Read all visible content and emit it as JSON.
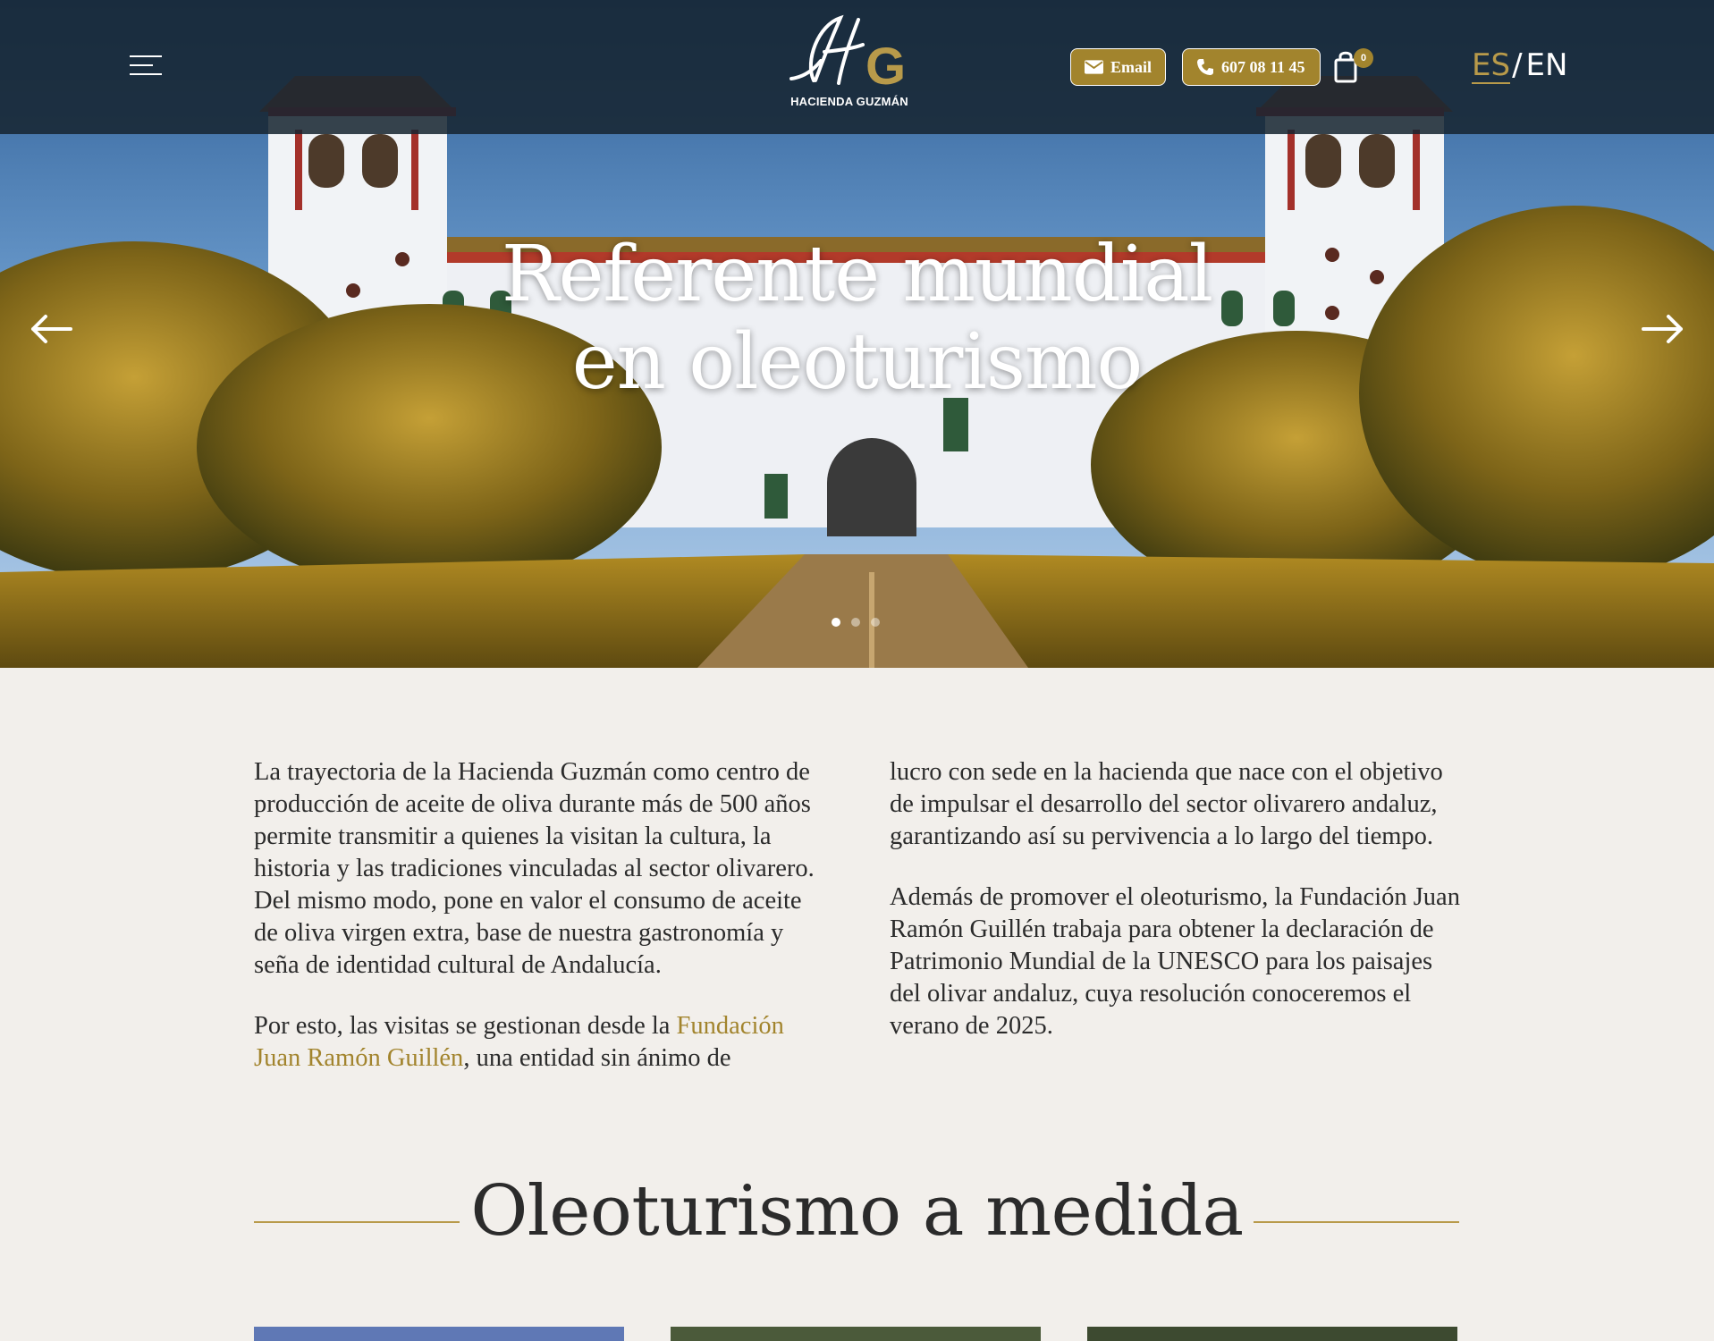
{
  "header": {
    "logo_text": "HACIENDA GUZMÁN",
    "logo_letters": "HG",
    "email_label": "Email",
    "phone_label": "607 08 11 45",
    "cart_count": "0",
    "lang_es": "ES",
    "lang_separator": "/",
    "lang_en": "EN",
    "icons": [
      "menu-icon",
      "email-icon",
      "phone-icon",
      "shopping-bag-icon",
      "arrow-left-icon",
      "arrow-right-icon"
    ]
  },
  "hero": {
    "title_line1": "Referente mundial",
    "title_line2": "en oleoturismo",
    "slides_total": 3,
    "active_slide": 1
  },
  "intro": {
    "para1": "La trayectoria de la Hacienda Guzmán como centro de producción de aceite de oliva durante más de 500 años permite transmitir a quienes la visitan la cultura, la historia y las tradiciones vinculadas al sector olivarero. Del mismo modo, pone en valor el consumo de aceite de oliva virgen extra, base de nuestra gastronomía y seña de identidad cultural de Andalucía.",
    "para2_before": "Por esto, las visitas se gestionan desde la ",
    "para2_link": "Fundación Juan Ramón Guillén",
    "para2_after": ", una entidad sin ánimo de lucro con sede en la hacienda que nace con el objetivo de impulsar el desarrollo del sector olivarero andaluz, garantizando así su pervivencia a lo largo del tiempo.",
    "para3": "Además de promover el oleoturismo, la Fundación Juan Ramón Guillén trabaja para obtener la declaración de Patrimonio Mundial de la UNESCO para los paisajes del olivar andaluz, cuya resolución conoceremos el verano de 2025."
  },
  "section": {
    "title": "Oleoturismo a medida"
  },
  "colors": {
    "accent": "#a2842d",
    "header_bg": "#162430",
    "page_bg": "#f2efeb",
    "text": "#2b2b2b"
  }
}
